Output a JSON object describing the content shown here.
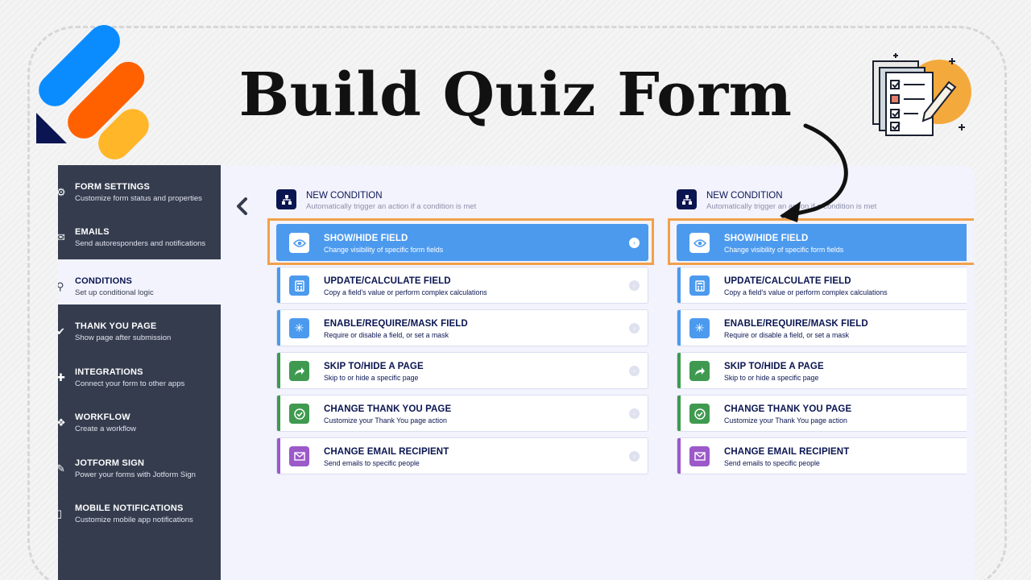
{
  "title": "Build Quiz Form",
  "colors": {
    "sidebar_bg": "#343c4e",
    "panel_bg": "#f3f3fe",
    "selected_blue": "#4c9aee",
    "highlight_orange": "#f2a04a",
    "navy": "#0a1551",
    "logo_blue": "#0a8cff",
    "logo_orange": "#ff6100",
    "logo_yellow": "#ffb629"
  },
  "sidebar": {
    "items": [
      {
        "label": "FORM SETTINGS",
        "sub": "Customize form status and properties",
        "icon": "gear-icon"
      },
      {
        "label": "EMAILS",
        "sub": "Send autoresponders and notifications",
        "icon": "envelope-icon"
      },
      {
        "label": "CONDITIONS",
        "sub": "Set up conditional logic",
        "icon": "hierarchy-icon",
        "active": true
      },
      {
        "label": "THANK YOU PAGE",
        "sub": "Show page after submission",
        "icon": "check-circle-icon"
      },
      {
        "label": "INTEGRATIONS",
        "sub": "Connect your form to other apps",
        "icon": "puzzle-icon"
      },
      {
        "label": "WORKFLOW",
        "sub": "Create a workflow",
        "icon": "workflow-icon"
      },
      {
        "label": "JOTFORM SIGN",
        "sub": "Power your forms with Jotform Sign",
        "icon": "pen-icon"
      },
      {
        "label": "MOBILE NOTIFICATIONS",
        "sub": "Customize mobile app notifications",
        "icon": "mobile-icon"
      }
    ]
  },
  "condition": {
    "title": "NEW CONDITION",
    "subtitle": "Automatically trigger an action if a condition is met"
  },
  "actions": [
    {
      "title": "SHOW/HIDE FIELD",
      "sub": "Change visibility of specific form fields",
      "icon": "eye-icon",
      "color": "#4c9aee",
      "selected": true
    },
    {
      "title": "UPDATE/CALCULATE FIELD",
      "sub": "Copy a field's value or perform complex calculations",
      "icon": "calculator-icon",
      "color": "#4c9aee"
    },
    {
      "title": "ENABLE/REQUIRE/MASK FIELD",
      "sub": "Require or disable a field, or set a mask",
      "icon": "asterisk-icon",
      "color": "#4c9aee"
    },
    {
      "title": "SKIP TO/HIDE A PAGE",
      "sub": "Skip to or hide a specific page",
      "icon": "share-arrow-icon",
      "color": "#3f9a50"
    },
    {
      "title": "CHANGE THANK YOU PAGE",
      "sub": "Customize your Thank You page action",
      "icon": "check-icon",
      "color": "#3f9a50"
    },
    {
      "title": "CHANGE EMAIL RECIPIENT",
      "sub": "Send emails to specific people",
      "icon": "mail-icon",
      "color": "#9b59c9"
    }
  ]
}
